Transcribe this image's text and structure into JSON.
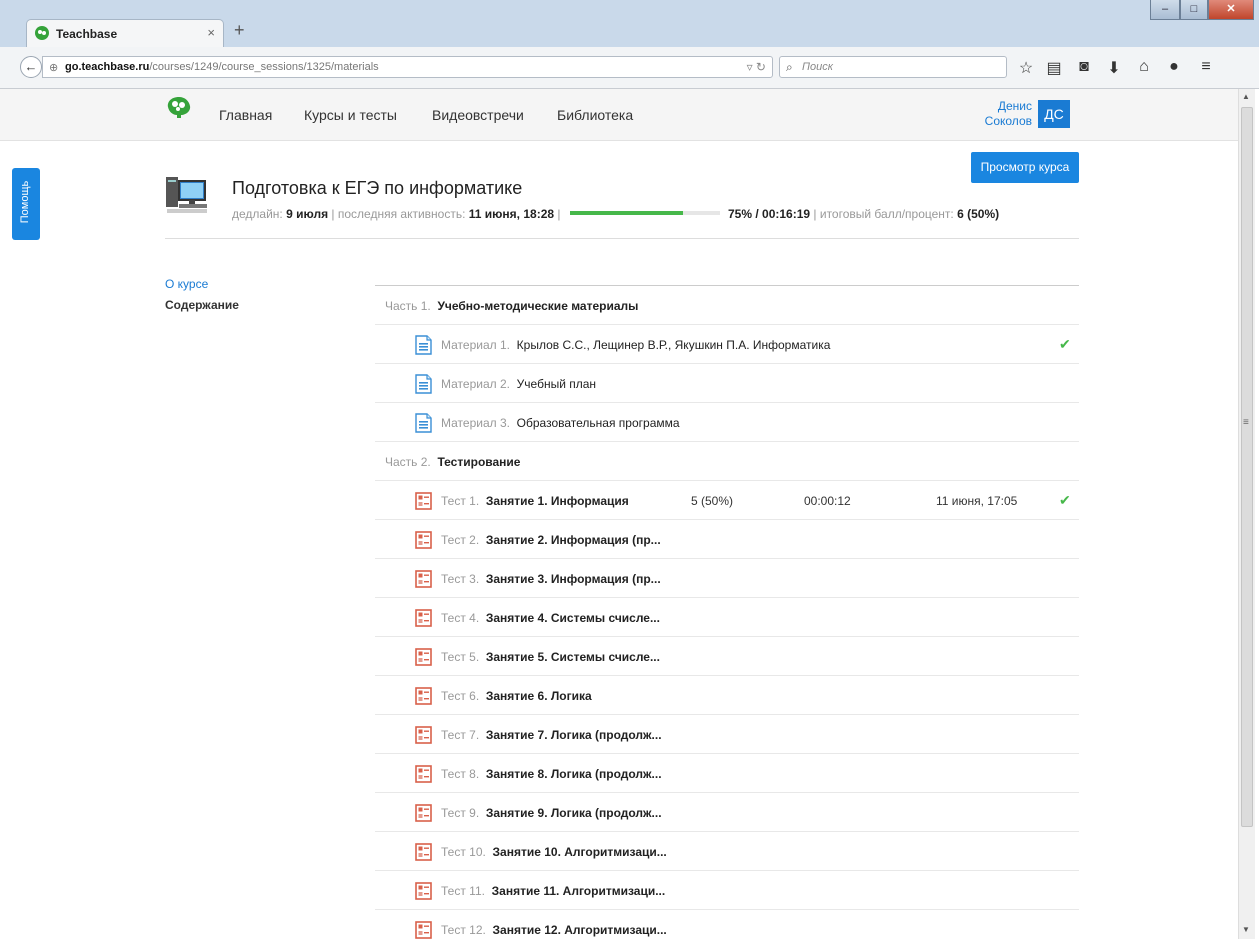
{
  "browser": {
    "tab_title": "Teachbase",
    "tab_close": "×",
    "new_tab": "+",
    "url_domain": "go.teachbase.ru",
    "url_path": "/courses/1249/course_sessions/1325/materials",
    "search_placeholder": "Поиск"
  },
  "header": {
    "nav": [
      "Главная",
      "Курсы и тесты",
      "Видеовстречи",
      "Библиотека"
    ],
    "user_first": "Денис",
    "user_last": "Соколов",
    "avatar_initials": "ДС"
  },
  "help_label": "Помощь",
  "course": {
    "title": "Подготовка к ЕГЭ по информатике",
    "deadline_label": "дедлайн:",
    "deadline": "9 июля",
    "activity_label": "последняя активность:",
    "activity": "11 июня, 18:28",
    "progress_percent": 75,
    "progress_text": "75% / 00:16:19",
    "score_label": "итоговый балл/процент:",
    "score": "6 (50%)",
    "view_button": "Просмотр курса"
  },
  "sidebar": {
    "about": "О курсе",
    "content": "Содержание"
  },
  "parts": [
    {
      "label": "Часть 1.",
      "title": "Учебно-методические материалы",
      "items": [
        {
          "type": "material",
          "label": "Материал 1.",
          "title": "Крылов С.С., Лещинер В.Р., Якушкин П.А. Информатика",
          "completed": true
        },
        {
          "type": "material",
          "label": "Материал 2.",
          "title": "Учебный план",
          "completed": false
        },
        {
          "type": "material",
          "label": "Материал 3.",
          "title": "Образовательная программа",
          "completed": false
        }
      ]
    },
    {
      "label": "Часть 2.",
      "title": "Тестирование",
      "items": [
        {
          "type": "test",
          "label": "Тест 1.",
          "title": "Занятие 1. Информация",
          "score": "5 (50%)",
          "time": "00:00:12",
          "date": "11 июня, 17:05",
          "completed": true
        },
        {
          "type": "test",
          "label": "Тест 2.",
          "title": "Занятие 2. Информация (пр...",
          "completed": false
        },
        {
          "type": "test",
          "label": "Тест 3.",
          "title": "Занятие 3. Информация (пр...",
          "completed": false
        },
        {
          "type": "test",
          "label": "Тест 4.",
          "title": "Занятие 4. Системы счисле...",
          "completed": false
        },
        {
          "type": "test",
          "label": "Тест 5.",
          "title": "Занятие 5. Системы счисле...",
          "completed": false
        },
        {
          "type": "test",
          "label": "Тест 6.",
          "title": "Занятие 6. Логика",
          "completed": false
        },
        {
          "type": "test",
          "label": "Тест 7.",
          "title": "Занятие 7. Логика (продолж...",
          "completed": false
        },
        {
          "type": "test",
          "label": "Тест 8.",
          "title": "Занятие 8. Логика (продолж...",
          "completed": false
        },
        {
          "type": "test",
          "label": "Тест 9.",
          "title": "Занятие 9. Логика (продолж...",
          "completed": false
        },
        {
          "type": "test",
          "label": "Тест 10.",
          "title": "Занятие 10. Алгоритмизаци...",
          "completed": false
        },
        {
          "type": "test",
          "label": "Тест 11.",
          "title": "Занятие 11. Алгоритмизаци...",
          "completed": false
        },
        {
          "type": "test",
          "label": "Тест 12.",
          "title": "Занятие 12. Алгоритмизаци...",
          "completed": false
        }
      ]
    }
  ],
  "colors": {
    "accent": "#1a86e0",
    "link": "#1a7bd3",
    "success": "#46b84a"
  }
}
